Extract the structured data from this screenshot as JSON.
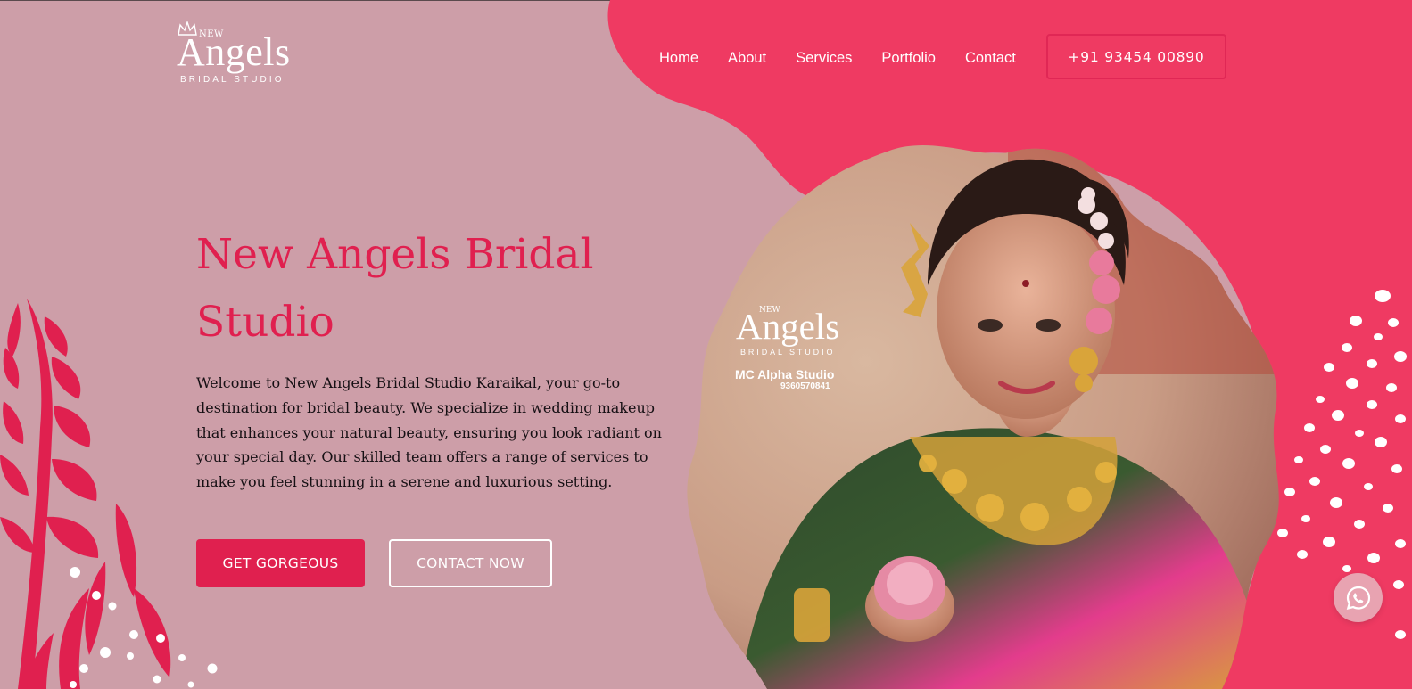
{
  "logo": {
    "small": "NEW",
    "main": "Angels",
    "sub": "BRIDAL STUDIO"
  },
  "nav": {
    "items": [
      "Home",
      "About",
      "Services",
      "Portfolio",
      "Contact"
    ],
    "phone": "+91 93454 00890"
  },
  "hero": {
    "title": "New Angels Bridal Studio",
    "description": "Welcome to New Angels Bridal Studio Karaikal, your go-to destination for bridal beauty. We specialize in wedding makeup that enhances your natural beauty, ensuring you look radiant on your special day. Our skilled team offers a range of services to make you feel stunning in a serene and luxurious setting.",
    "primary_button": "GET GORGEOUS",
    "secondary_button": "CONTACT NOW"
  },
  "photo": {
    "watermark_small": "NEW",
    "watermark_main": "Angels",
    "watermark_sub": "BRIDAL STUDIO",
    "watermark_studio": "MC Alpha Studio",
    "watermark_phone": "9360570841"
  },
  "floating": {
    "icon": "whatsapp-icon"
  },
  "colors": {
    "background": "#cd9ea8",
    "accent": "#e0204f",
    "accent_shape": "#ef3a62",
    "text": "#161014"
  }
}
